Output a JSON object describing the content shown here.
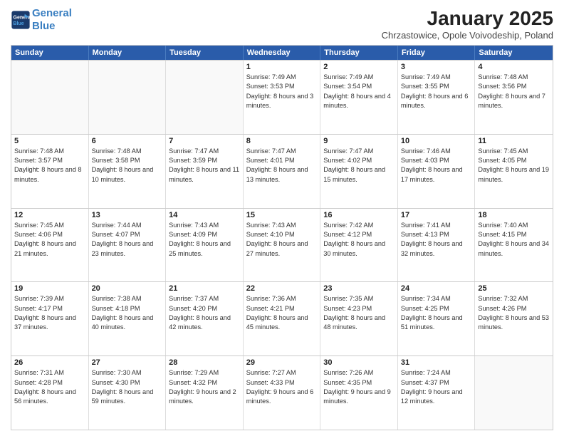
{
  "header": {
    "logo_line1": "General",
    "logo_line2": "Blue",
    "month": "January 2025",
    "location": "Chrzastowice, Opole Voivodeship, Poland"
  },
  "weekdays": [
    "Sunday",
    "Monday",
    "Tuesday",
    "Wednesday",
    "Thursday",
    "Friday",
    "Saturday"
  ],
  "weeks": [
    [
      {
        "day": "",
        "sunrise": "",
        "sunset": "",
        "daylight": ""
      },
      {
        "day": "",
        "sunrise": "",
        "sunset": "",
        "daylight": ""
      },
      {
        "day": "",
        "sunrise": "",
        "sunset": "",
        "daylight": ""
      },
      {
        "day": "1",
        "sunrise": "Sunrise: 7:49 AM",
        "sunset": "Sunset: 3:53 PM",
        "daylight": "Daylight: 8 hours and 3 minutes."
      },
      {
        "day": "2",
        "sunrise": "Sunrise: 7:49 AM",
        "sunset": "Sunset: 3:54 PM",
        "daylight": "Daylight: 8 hours and 4 minutes."
      },
      {
        "day": "3",
        "sunrise": "Sunrise: 7:49 AM",
        "sunset": "Sunset: 3:55 PM",
        "daylight": "Daylight: 8 hours and 6 minutes."
      },
      {
        "day": "4",
        "sunrise": "Sunrise: 7:48 AM",
        "sunset": "Sunset: 3:56 PM",
        "daylight": "Daylight: 8 hours and 7 minutes."
      }
    ],
    [
      {
        "day": "5",
        "sunrise": "Sunrise: 7:48 AM",
        "sunset": "Sunset: 3:57 PM",
        "daylight": "Daylight: 8 hours and 8 minutes."
      },
      {
        "day": "6",
        "sunrise": "Sunrise: 7:48 AM",
        "sunset": "Sunset: 3:58 PM",
        "daylight": "Daylight: 8 hours and 10 minutes."
      },
      {
        "day": "7",
        "sunrise": "Sunrise: 7:47 AM",
        "sunset": "Sunset: 3:59 PM",
        "daylight": "Daylight: 8 hours and 11 minutes."
      },
      {
        "day": "8",
        "sunrise": "Sunrise: 7:47 AM",
        "sunset": "Sunset: 4:01 PM",
        "daylight": "Daylight: 8 hours and 13 minutes."
      },
      {
        "day": "9",
        "sunrise": "Sunrise: 7:47 AM",
        "sunset": "Sunset: 4:02 PM",
        "daylight": "Daylight: 8 hours and 15 minutes."
      },
      {
        "day": "10",
        "sunrise": "Sunrise: 7:46 AM",
        "sunset": "Sunset: 4:03 PM",
        "daylight": "Daylight: 8 hours and 17 minutes."
      },
      {
        "day": "11",
        "sunrise": "Sunrise: 7:45 AM",
        "sunset": "Sunset: 4:05 PM",
        "daylight": "Daylight: 8 hours and 19 minutes."
      }
    ],
    [
      {
        "day": "12",
        "sunrise": "Sunrise: 7:45 AM",
        "sunset": "Sunset: 4:06 PM",
        "daylight": "Daylight: 8 hours and 21 minutes."
      },
      {
        "day": "13",
        "sunrise": "Sunrise: 7:44 AM",
        "sunset": "Sunset: 4:07 PM",
        "daylight": "Daylight: 8 hours and 23 minutes."
      },
      {
        "day": "14",
        "sunrise": "Sunrise: 7:43 AM",
        "sunset": "Sunset: 4:09 PM",
        "daylight": "Daylight: 8 hours and 25 minutes."
      },
      {
        "day": "15",
        "sunrise": "Sunrise: 7:43 AM",
        "sunset": "Sunset: 4:10 PM",
        "daylight": "Daylight: 8 hours and 27 minutes."
      },
      {
        "day": "16",
        "sunrise": "Sunrise: 7:42 AM",
        "sunset": "Sunset: 4:12 PM",
        "daylight": "Daylight: 8 hours and 30 minutes."
      },
      {
        "day": "17",
        "sunrise": "Sunrise: 7:41 AM",
        "sunset": "Sunset: 4:13 PM",
        "daylight": "Daylight: 8 hours and 32 minutes."
      },
      {
        "day": "18",
        "sunrise": "Sunrise: 7:40 AM",
        "sunset": "Sunset: 4:15 PM",
        "daylight": "Daylight: 8 hours and 34 minutes."
      }
    ],
    [
      {
        "day": "19",
        "sunrise": "Sunrise: 7:39 AM",
        "sunset": "Sunset: 4:17 PM",
        "daylight": "Daylight: 8 hours and 37 minutes."
      },
      {
        "day": "20",
        "sunrise": "Sunrise: 7:38 AM",
        "sunset": "Sunset: 4:18 PM",
        "daylight": "Daylight: 8 hours and 40 minutes."
      },
      {
        "day": "21",
        "sunrise": "Sunrise: 7:37 AM",
        "sunset": "Sunset: 4:20 PM",
        "daylight": "Daylight: 8 hours and 42 minutes."
      },
      {
        "day": "22",
        "sunrise": "Sunrise: 7:36 AM",
        "sunset": "Sunset: 4:21 PM",
        "daylight": "Daylight: 8 hours and 45 minutes."
      },
      {
        "day": "23",
        "sunrise": "Sunrise: 7:35 AM",
        "sunset": "Sunset: 4:23 PM",
        "daylight": "Daylight: 8 hours and 48 minutes."
      },
      {
        "day": "24",
        "sunrise": "Sunrise: 7:34 AM",
        "sunset": "Sunset: 4:25 PM",
        "daylight": "Daylight: 8 hours and 51 minutes."
      },
      {
        "day": "25",
        "sunrise": "Sunrise: 7:32 AM",
        "sunset": "Sunset: 4:26 PM",
        "daylight": "Daylight: 8 hours and 53 minutes."
      }
    ],
    [
      {
        "day": "26",
        "sunrise": "Sunrise: 7:31 AM",
        "sunset": "Sunset: 4:28 PM",
        "daylight": "Daylight: 8 hours and 56 minutes."
      },
      {
        "day": "27",
        "sunrise": "Sunrise: 7:30 AM",
        "sunset": "Sunset: 4:30 PM",
        "daylight": "Daylight: 8 hours and 59 minutes."
      },
      {
        "day": "28",
        "sunrise": "Sunrise: 7:29 AM",
        "sunset": "Sunset: 4:32 PM",
        "daylight": "Daylight: 9 hours and 2 minutes."
      },
      {
        "day": "29",
        "sunrise": "Sunrise: 7:27 AM",
        "sunset": "Sunset: 4:33 PM",
        "daylight": "Daylight: 9 hours and 6 minutes."
      },
      {
        "day": "30",
        "sunrise": "Sunrise: 7:26 AM",
        "sunset": "Sunset: 4:35 PM",
        "daylight": "Daylight: 9 hours and 9 minutes."
      },
      {
        "day": "31",
        "sunrise": "Sunrise: 7:24 AM",
        "sunset": "Sunset: 4:37 PM",
        "daylight": "Daylight: 9 hours and 12 minutes."
      },
      {
        "day": "",
        "sunrise": "",
        "sunset": "",
        "daylight": ""
      }
    ]
  ]
}
